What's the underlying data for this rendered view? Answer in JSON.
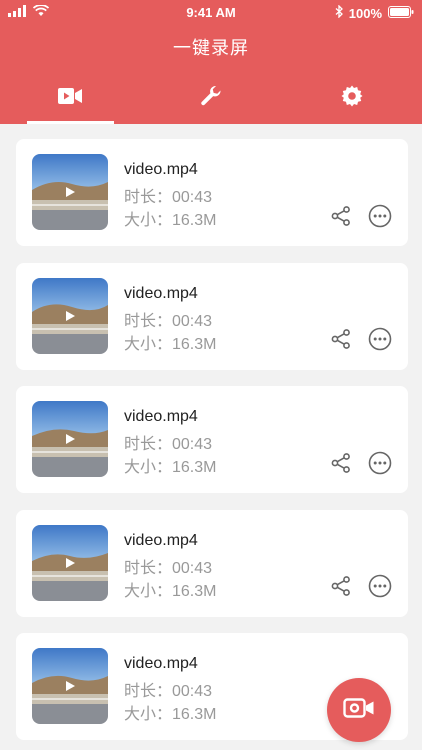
{
  "status_bar": {
    "time": "9:41 AM",
    "battery": "100%"
  },
  "header": {
    "title": "一键录屏"
  },
  "tabs": [
    {
      "icon": "video-camera-icon",
      "active": true
    },
    {
      "icon": "wrench-icon",
      "active": false
    },
    {
      "icon": "gear-icon",
      "active": false
    }
  ],
  "videos": [
    {
      "name": "video.mp4",
      "duration": "时长：00:43",
      "size": "大小：16.3M"
    },
    {
      "name": "video.mp4",
      "duration": "时长：00:43",
      "size": "大小：16.3M"
    },
    {
      "name": "video.mp4",
      "duration": "时长：00:43",
      "size": "大小：16.3M"
    },
    {
      "name": "video.mp4",
      "duration": "时长：00:43",
      "size": "大小：16.3M"
    },
    {
      "name": "video.mp4",
      "duration": "时长：00:43",
      "size": "大小：16.3M"
    }
  ],
  "colors": {
    "accent": "#e55c5c",
    "background": "#f2f2f2"
  }
}
